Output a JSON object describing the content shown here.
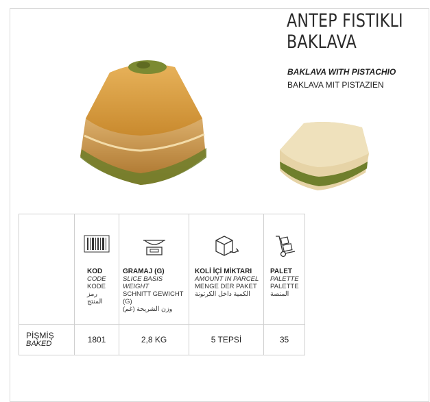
{
  "product": {
    "title_line1": "ANTEP FISTIKLI",
    "title_line2": "BAKLAVA",
    "name_en": "BAKLAVA WITH PISTACHIO",
    "name_de": "BAKLAVA MIT PISTAZIEN"
  },
  "table": {
    "columns": [
      {
        "icon": "barcode-icon",
        "tr": "KOD",
        "en": "CODE",
        "de": "KODE",
        "ar": "رمز المنتج"
      },
      {
        "icon": "scale-icon",
        "tr": "GRAMAJ (G)",
        "en": "SLICE BASIS WEIGHT",
        "de": "SCHNITT GEWICHT (G)",
        "ar": "(وزن الشريحة (غم"
      },
      {
        "icon": "box-return-icon",
        "tr": "KOLİ İÇİ MİKTARI",
        "en": "AMOUNT IN PARCEL",
        "de": "MENGE DER PAKET",
        "ar": "الكمية داخل الكرتونة"
      },
      {
        "icon": "hand-truck-icon",
        "tr": "PALET",
        "en": "PALETTE",
        "de": "PALETTE",
        "ar": "المنصة"
      }
    ],
    "row": {
      "label_tr": "PİŞMİŞ",
      "label_en": "BAKED",
      "values": [
        "1801",
        "2,8 KG",
        "5 TEPSİ",
        "35"
      ]
    }
  },
  "colors": {
    "text": "#222222",
    "border": "#cfcfcf",
    "pastry_gold": "#c98a2e",
    "pistachio": "#6f7f2c"
  }
}
